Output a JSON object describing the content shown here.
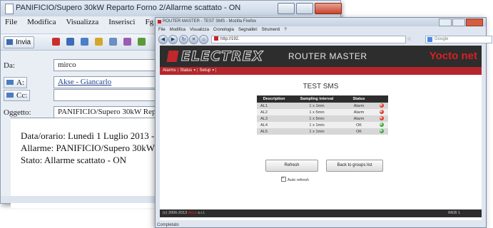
{
  "mail": {
    "title": "PANIFICIO/Supero 30kW Reparto Forno 2/Allarme scattato - ON",
    "menu": [
      "File",
      "Modifica",
      "Visualizza",
      "Inserisci",
      "Fg"
    ],
    "send_label": "Invia",
    "from_label": "Da:",
    "from_value": "mirco",
    "to_label": "A:",
    "to_value": "Akse - Giancarlo",
    "cc_label": "Cc:",
    "cc_value": "",
    "subject_label": "Oggetto:",
    "subject_value": "PANIFICIO/Supero 30kW Reparto",
    "body": [
      "Data/orario: Lunedì  1 Luglio 2013 -",
      "Allarme: PANIFICIO/Supero 30kW R",
      "Stato: Allarme scattato - ON"
    ]
  },
  "browser": {
    "title": "ROUTER MASTER - TEST SMS - Mozilla Firefox",
    "menu": [
      "File",
      "Modifica",
      "Visualizza",
      "Cronologia",
      "Segnalibri",
      "Strumenti",
      "?"
    ],
    "url": "http://192.",
    "search_placeholder": "Google",
    "status": "Completato"
  },
  "page": {
    "logo": "ELECTREX",
    "header_title": "ROUTER MASTER",
    "brand_a": "Yocto",
    "brand_b": "net",
    "nav": [
      "Alarms",
      "Status",
      "Setup"
    ],
    "title": "TEST SMS",
    "table": {
      "headers": [
        "Description",
        "Sampling interval",
        "Status",
        ""
      ],
      "rows": [
        {
          "desc": "AL1",
          "interval": "1 x 1min",
          "status": "Alarm",
          "led": "red"
        },
        {
          "desc": "AL2",
          "interval": "1 x 5min",
          "status": "Alarm",
          "led": "red"
        },
        {
          "desc": "AL3",
          "interval": "1 x 5min",
          "status": "Alarm",
          "led": "red"
        },
        {
          "desc": "AL4",
          "interval": "1 x 1min",
          "status": "OK",
          "led": "green"
        },
        {
          "desc": "AL5",
          "interval": "1 x 1min",
          "status": "OK",
          "led": "green"
        }
      ]
    },
    "refresh_label": "Refresh",
    "back_label": "Back to groups list",
    "autorefresh_label": "Auto refresh",
    "footer_copy": "(c) 2006-2013",
    "footer_brand": "Akse",
    "footer_suffix": "s.r.l.",
    "footer_version": "WEB 1"
  },
  "colors": {
    "red_led": "#d83a2a",
    "green_led": "#3aa83a",
    "accent": "#b4262b"
  }
}
